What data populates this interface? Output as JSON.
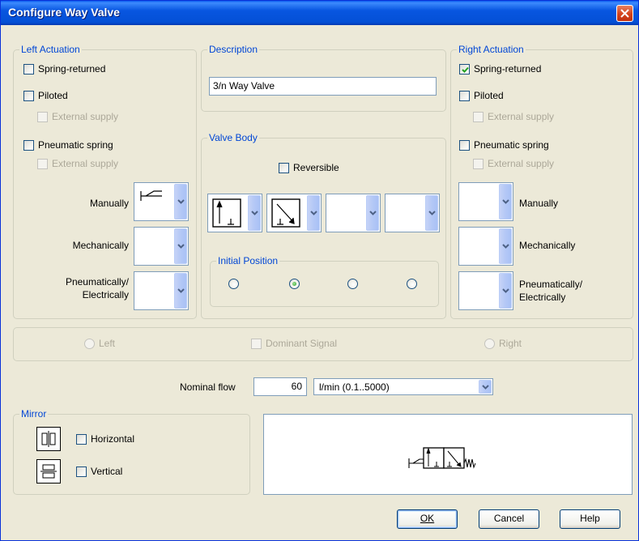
{
  "window": {
    "title": "Configure Way Valve"
  },
  "left": {
    "legend": "Left Actuation",
    "spring_returned": {
      "label": "Spring-returned",
      "checked": false
    },
    "piloted": {
      "label": "Piloted",
      "checked": false
    },
    "piloted_ext": {
      "label": "External supply",
      "checked": false
    },
    "pneumatic_spring": {
      "label": "Pneumatic spring",
      "checked": false
    },
    "pneu_ext": {
      "label": "External supply",
      "checked": false
    },
    "manually_label": "Manually",
    "mechanically_label": "Mechanically",
    "pneu_elec_label1": "Pneumatically/",
    "pneu_elec_label2": "Electrically",
    "manually_icon": "manual-lever-icon"
  },
  "description": {
    "legend": "Description",
    "value": "3/n Way Valve"
  },
  "valve_body": {
    "legend": "Valve Body",
    "reversible": {
      "label": "Reversible",
      "checked": false
    },
    "cells": [
      "valve-cell-flow-up-icon",
      "valve-cell-flow-diagonal-icon",
      "",
      ""
    ],
    "initial_position": {
      "legend": "Initial Position",
      "selected": 1,
      "count": 4
    }
  },
  "right": {
    "legend": "Right Actuation",
    "spring_returned": {
      "label": "Spring-returned",
      "checked": true
    },
    "piloted": {
      "label": "Piloted",
      "checked": false
    },
    "piloted_ext": {
      "label": "External supply",
      "checked": false
    },
    "pneumatic_spring": {
      "label": "Pneumatic spring",
      "checked": false
    },
    "pneu_ext": {
      "label": "External supply",
      "checked": false
    },
    "manually_label": "Manually",
    "mechanically_label": "Mechanically",
    "pneu_elec_label1": "Pneumatically/",
    "pneu_elec_label2": "Electrically"
  },
  "dominant": {
    "left": "Left",
    "signal": "Dominant Signal",
    "right": "Right"
  },
  "flow": {
    "label": "Nominal flow",
    "value": "60",
    "unit": "l/min  (0.1..5000)"
  },
  "mirror": {
    "legend": "Mirror",
    "horizontal": {
      "label": "Horizontal",
      "checked": false
    },
    "vertical": {
      "label": "Vertical",
      "checked": false
    }
  },
  "buttons": {
    "ok": "OK",
    "cancel": "Cancel",
    "help": "Help"
  },
  "colors": {
    "accent": "#0046d5",
    "titlebar": "#0450d6",
    "check": "#21a121"
  }
}
